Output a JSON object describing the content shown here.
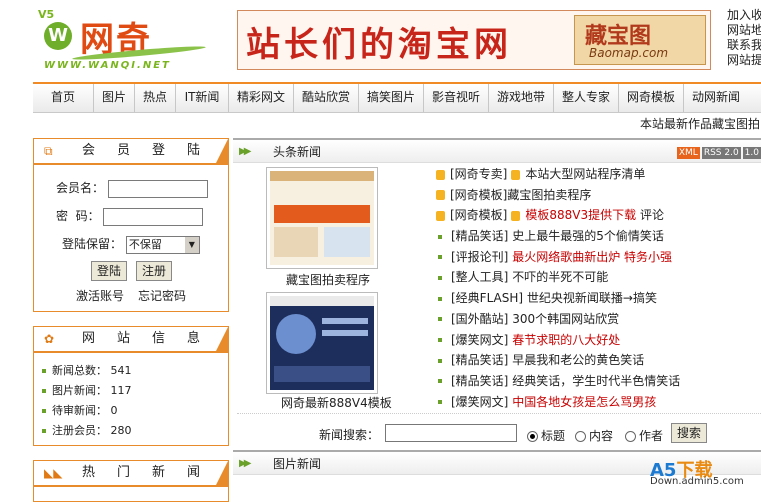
{
  "logo": {
    "version": "V5",
    "initial": "W",
    "name": "网奇",
    "url": "WWW.WANQI.NET"
  },
  "banner": {
    "slogan": "站长们的淘宝网",
    "brand_cn": "藏宝图",
    "brand_en": "Baomap.com"
  },
  "top_links": [
    "加入收",
    "网站地",
    "联系我",
    "网站提"
  ],
  "nav": [
    "首页",
    "图片",
    "热点",
    "IT新闻",
    "精彩网文",
    "酷站欣赏",
    "搞笑图片",
    "影音视听",
    "游戏地带",
    "整人专家",
    "网奇模板",
    "动网新闻"
  ],
  "marquee": "本站最新作品藏宝图拍",
  "login": {
    "title": "会员登陆",
    "username_label": "会员名：",
    "password_label": "密  码：",
    "keep_label": "登陆保留：",
    "keep_value": "不保留",
    "login_btn": "登陆",
    "register_btn": "注册",
    "activate_link": "激活账号",
    "forgot_link": "忘记密码"
  },
  "site_info": {
    "title": "网站信息",
    "items": [
      "新闻总数： 541",
      "图片新闻： 117",
      "待审新闻： 0",
      "注册会员： 280"
    ]
  },
  "hot_news": {
    "title": "热门新闻"
  },
  "headlines": {
    "title": "头条新闻",
    "badges": [
      "XML",
      "RSS 2.0",
      "1.0"
    ],
    "thumb1_caption": "藏宝图拍卖程序",
    "thumb2_caption": "网奇最新888V4模板",
    "items": [
      {
        "cat": "[网奇专卖]",
        "text": "本站大型网站程序清单",
        "extra": ""
      },
      {
        "cat": "[网奇模板]",
        "text": "藏宝图拍卖程序",
        "extra": ""
      },
      {
        "cat": "[网奇模板]",
        "text": "模板888V3提供下载",
        "extra": "评论"
      },
      {
        "cat": "[精品笑话]",
        "text": "史上最牛最强的5个偷情笑话",
        "extra": ""
      },
      {
        "cat": "[评报论刊]",
        "text": "最火网络歌曲新出炉 特务小强",
        "extra": ""
      },
      {
        "cat": "[整人工具]",
        "text": "不吓的半死不可能",
        "extra": ""
      },
      {
        "cat": "[经典FLASH]",
        "text": "世纪央视新闻联播→搞笑",
        "extra": ""
      },
      {
        "cat": "[国外酷站]",
        "text": "300个韩国网站欣赏",
        "extra": ""
      },
      {
        "cat": "[爆笑网文]",
        "text": "春节求职的八大好处",
        "extra": ""
      },
      {
        "cat": "[精品笑话]",
        "text": "早晨我和老公的黄色笑话",
        "extra": ""
      },
      {
        "cat": "[精品笑话]",
        "text": "经典笑话，学生时代半色情笑话",
        "extra": ""
      },
      {
        "cat": "[爆笑网文]",
        "text": "中国各地女孩是怎么骂男孩",
        "extra": ""
      }
    ]
  },
  "search": {
    "label": "新闻搜索：",
    "opt_title": "标题",
    "opt_content": "内容",
    "opt_author": "作者",
    "button": "搜索"
  },
  "pictures": {
    "title": "图片新闻"
  },
  "watermark": {
    "a5": "A5",
    "dl": "下载",
    "site": "Down.admin5.com"
  }
}
